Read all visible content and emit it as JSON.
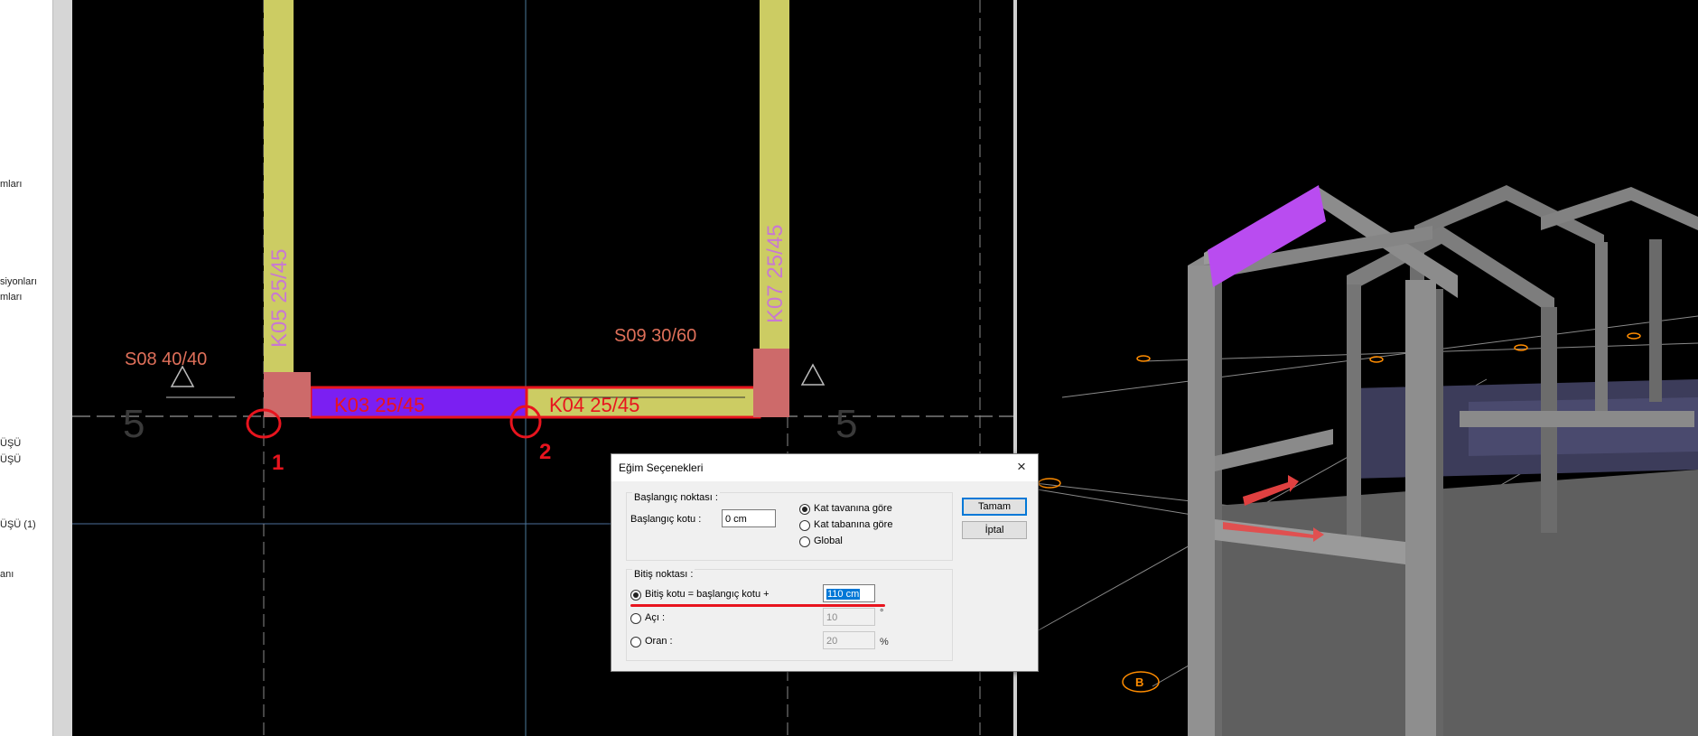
{
  "left_panel": {
    "items": [
      "mları",
      "siyonları",
      "mları",
      "ÜŞÜ",
      "ÜŞÜ",
      "ÜŞÜ (1)",
      "anı"
    ]
  },
  "plan": {
    "axis_label_left": "5",
    "axis_label_right": "5",
    "columns": [
      "S08 40/40",
      "S09 30/60"
    ],
    "beams": [
      "K05 25/45",
      "K07 25/45",
      "K03 25/45",
      "K04 25/45"
    ],
    "markers": [
      "1",
      "2"
    ]
  },
  "view3d": {
    "grid_bubble": "B"
  },
  "dialog": {
    "title": "Eğim Seçenekleri",
    "close_icon": "×",
    "start_group": {
      "title": "Başlangıç noktası :",
      "start_level_label": "Başlangıç kotu :",
      "start_level_value": "0 cm",
      "options": [
        "Kat tavanına göre",
        "Kat tabanına göre",
        "Global"
      ],
      "selected": "Kat tavanına göre"
    },
    "end_group": {
      "title": "Bitiş noktası :",
      "options": [
        {
          "label": "Bitiş kotu = başlangıç kotu +",
          "value": "110 cm",
          "unit": ""
        },
        {
          "label": "Açı :",
          "value": "10",
          "unit": "°"
        },
        {
          "label": "Oran :",
          "value": "20",
          "unit": "%"
        }
      ],
      "selected": "Bitiş kotu = başlangıç kotu +"
    },
    "ok_label": "Tamam",
    "cancel_label": "İptal"
  },
  "colors": {
    "beam_yellow": "#cccc63",
    "beam_purple": "#7b1ff2",
    "column_red": "#cd6a6a",
    "annotation_red": "#e8141e",
    "label_pink": "#c878d2",
    "label_red": "#e0705a",
    "selection_blue": "#0078d7"
  }
}
